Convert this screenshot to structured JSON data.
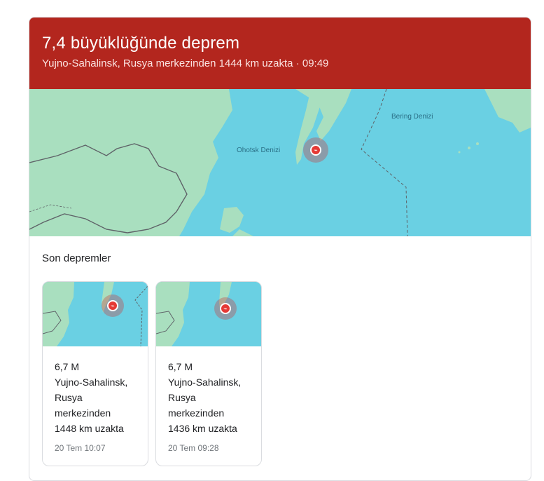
{
  "header": {
    "title": "7,4 büyüklüğünde deprem",
    "subtitle": "Yujno-Sahalinsk, Rusya merkezinden 1444 km uzakta · 09:49"
  },
  "map": {
    "labels": {
      "okhotsk": "Ohotsk Denizi",
      "bering": "Bering Denizi"
    },
    "colors": {
      "sea": "#6ad0e3",
      "land": "#a9dfbf",
      "marker": "#e53935",
      "header": "#b3261e"
    }
  },
  "recent": {
    "title": "Son depremler",
    "items": [
      {
        "magnitude": "6,7 M",
        "location_lines": [
          "Yujno-Sahalinsk,",
          "Rusya",
          "merkezinden",
          "1448 km uzakta"
        ],
        "time": "20 Tem 10:07"
      },
      {
        "magnitude": "6,7 M",
        "location_lines": [
          "Yujno-Sahalinsk,",
          "Rusya",
          "merkezinden",
          "1436 km uzakta"
        ],
        "time": "20 Tem 09:28"
      }
    ]
  }
}
